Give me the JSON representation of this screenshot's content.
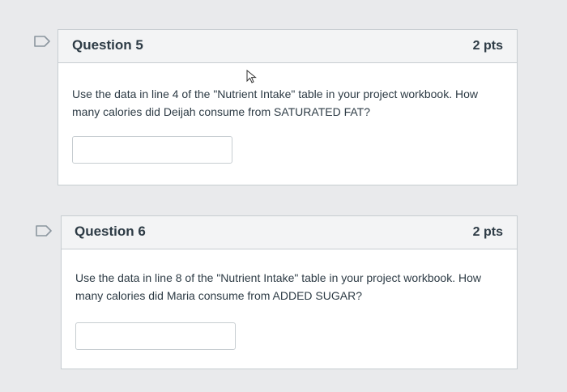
{
  "questions": [
    {
      "title": "Question 5",
      "points": "2 pts",
      "text": "Use the data in line 4 of the \"Nutrient Intake\" table in your project workbook. How many calories did Deijah consume from SATURATED FAT?",
      "answer": ""
    },
    {
      "title": "Question 6",
      "points": "2 pts",
      "text": "Use the data in line 8 of the \"Nutrient Intake\" table in your project workbook. How many calories did Maria consume from ADDED SUGAR?",
      "answer": ""
    }
  ],
  "icons": {
    "flag": "bookmark-flag-icon",
    "cursor": "mouse-pointer-icon"
  },
  "colors": {
    "page_bg": "#e9eaec",
    "header_bg": "#f3f4f5",
    "border": "#c7cdd1",
    "text": "#2d3b45"
  }
}
